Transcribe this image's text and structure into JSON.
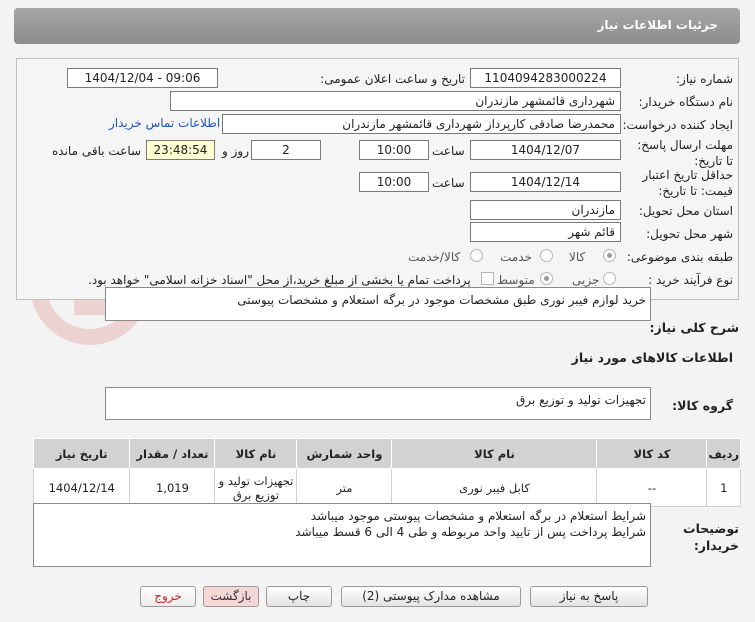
{
  "header": {
    "title": "جزئیات اطلاعات نیاز"
  },
  "form": {
    "need_number": {
      "label": "شماره نیاز:",
      "value": "1104094283000224"
    },
    "announce_datetime": {
      "label": "تاریخ و ساعت اعلان عمومی:",
      "value": "1404/12/04 - 09:06"
    },
    "buyer_org": {
      "label": "نام دستگاه خریدار:",
      "value": "شهرداری قائمشهر مازندران"
    },
    "requester": {
      "label": "ایجاد کننده درخواست:",
      "value": "محمدرضا صادقی کارپرداز شهرداری قائمشهر مازندران",
      "link": "اطلاعات تماس خریدار"
    },
    "deadline": {
      "label": "مهلت ارسال پاسخ: تا تاریخ:",
      "date": "1404/12/07",
      "time_label": "ساعت",
      "time": "10:00",
      "days": "2",
      "days_label": "روز و",
      "remaining": "23:48:54",
      "remaining_label": "ساعت باقی مانده"
    },
    "price_validity": {
      "label": "حداقل تاریخ اعتبار قیمت: تا تاریخ:",
      "date": "1404/12/14",
      "time_label": "ساعت",
      "time": "10:00"
    },
    "province": {
      "label": "استان محل تحویل:",
      "value": "مازندران"
    },
    "city": {
      "label": "شهر محل تحویل:",
      "value": "قائم شهر"
    },
    "category": {
      "label": "طبقه بندی موضوعی:",
      "options": [
        "کالا",
        "خدمت",
        "کالا/خدمت"
      ],
      "selected": "کالا"
    },
    "process": {
      "label": "نوع فرآیند خرید :",
      "options": [
        "جزیی",
        "متوسط"
      ],
      "selected": "جزیی",
      "note": "پرداخت تمام یا بخشی از مبلغ خرید،از محل \"اسناد خزانه اسلامی\" خواهد بود."
    }
  },
  "summary": {
    "label": "شرح کلی نیاز:",
    "value": "خرید لوازم فیبر نوری طبق مشخصات موجود در برگه استعلام و مشخصات پیوستی"
  },
  "goods_info": {
    "title": "اطلاعات کالاهای مورد نیاز"
  },
  "goods_group": {
    "label": "گروه کالا:",
    "value": "تجهیزات تولید و توزیع برق"
  },
  "table": {
    "headers": [
      "ردیف",
      "کد کالا",
      "نام کالا",
      "واحد شمارش",
      "تعداد / مقدار",
      "تاریخ نیاز"
    ],
    "rows": [
      [
        "1",
        "--",
        "کابل فیبر نوری",
        "متر",
        "1,019",
        "1404/12/14"
      ]
    ],
    "extra_header": "نام کالا",
    "group_cell": "تجهیزات تولید و توزیع برق"
  },
  "buyer_notes": {
    "label": "توضیحات خریدار:",
    "lines": [
      "شرایط استعلام در برگه استعلام و مشخصات پیوستی موجود میباشد",
      "شرایط پرداخت پس از تایید واحد مربوطه و طی 4 الی 6 قسط میباشد"
    ]
  },
  "buttons": {
    "reply": "پاسخ به نیاز",
    "attachments": "مشاهده مدارک پیوستی (2)",
    "print": "چاپ",
    "back": "بازگشت",
    "exit": "خروج"
  },
  "watermark": "AriaTender.net",
  "colors": {
    "header": "#999999",
    "link": "#1f56b8",
    "timer_bg": "#ffffd2",
    "exit_text": "#cc2222"
  }
}
